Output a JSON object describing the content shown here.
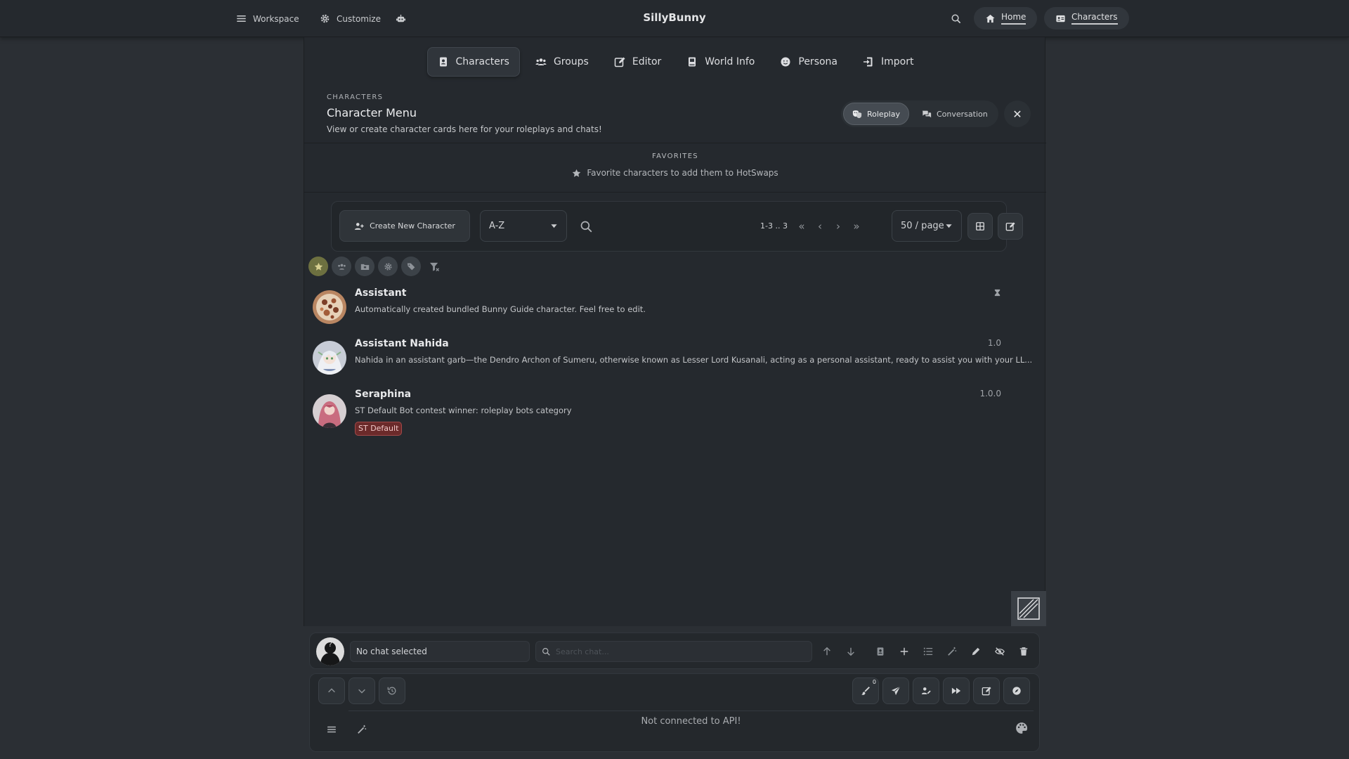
{
  "topbar": {
    "workspace_label": "Workspace",
    "customize_label": "Customize",
    "app_title": "SillyBunny",
    "home_label": "Home",
    "characters_label": "Characters"
  },
  "tabs": [
    {
      "label": "Characters",
      "icon": "character-card-icon",
      "active": true
    },
    {
      "label": "Groups",
      "icon": "users-icon",
      "active": false
    },
    {
      "label": "Editor",
      "icon": "edit-icon",
      "active": false
    },
    {
      "label": "World Info",
      "icon": "book-icon",
      "active": false
    },
    {
      "label": "Persona",
      "icon": "face-icon",
      "active": false
    },
    {
      "label": "Import",
      "icon": "import-icon",
      "active": false
    }
  ],
  "header": {
    "eyebrow": "CHARACTERS",
    "title": "Character Menu",
    "subtitle": "View or create character cards here for your roleplays and chats!",
    "mode_roleplay": "Roleplay",
    "mode_conversation": "Conversation",
    "close_glyph": "✕"
  },
  "favorites": {
    "title": "FAVORITES",
    "hint": "Favorite characters to add them to HotSwaps"
  },
  "toolbar": {
    "create_label": "Create New Character",
    "sort_value": "A-Z",
    "range_text": "1-3 .. 3",
    "per_page": "50 / page"
  },
  "characters": [
    {
      "name": "Assistant",
      "description": "Automatically created bundled Bunny Guide character. Feel free to edit.",
      "version": "",
      "tag": ""
    },
    {
      "name": "Assistant Nahida",
      "description": "Nahida in an assistant garb—the Dendro Archon of Sumeru, otherwise known as Lesser Lord Kusanali, acting as a personal assistant, ready to assist you with your LL...",
      "version": "1.0",
      "tag": ""
    },
    {
      "name": "Seraphina",
      "description": "ST Default Bot contest winner: roleplay bots category",
      "version": "1.0.0",
      "tag": "ST Default"
    }
  ],
  "chatbar": {
    "chat_selected": "No chat selected",
    "search_placeholder": "Search chat..."
  },
  "composer": {
    "status": "Not connected to API!",
    "badge_count": "0"
  },
  "colors": {
    "background": "#2b2f34",
    "panel": "#25292e",
    "favorite_active": "#6d7040",
    "tag_red": "#6b2a2a"
  }
}
